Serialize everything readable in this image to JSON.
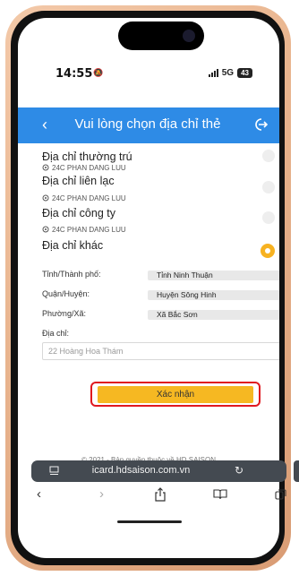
{
  "status": {
    "time": "14:55",
    "network": "5G",
    "battery": "43"
  },
  "header": {
    "title": "Vui lòng chọn địa chỉ thẻ"
  },
  "addresses": [
    {
      "label": "Địa chỉ thường trú",
      "detail": "24C PHAN DANG LUU",
      "selected": false
    },
    {
      "label": "Địa chỉ liên lạc",
      "detail": "24C PHAN DANG LUU",
      "selected": false
    },
    {
      "label": "Địa chỉ công ty",
      "detail": "24C PHAN DANG LUU",
      "selected": false
    },
    {
      "label": "Địa chỉ khác",
      "selected": true
    }
  ],
  "form": {
    "province_label": "Tỉnh/Thành phố:",
    "province_value": "Tỉnh Ninh Thuận",
    "district_label": "Quận/Huyện:",
    "district_value": "Huyện Sông Hinh",
    "ward_label": "Phường/Xã:",
    "ward_value": "Xã Bắc Sơn",
    "address_label": "Địa chỉ:",
    "address_value": "22 Hoàng Hoa Thám",
    "confirm_label": "Xác nhận"
  },
  "footer": {
    "text": "© 2021 - Bản quyền thuộc về HD SAISON"
  },
  "browser": {
    "url": "icard.hdsaison.com.vn"
  },
  "colors": {
    "header": "#2e8be6",
    "accent": "#f6b822",
    "highlight": "#e0191f"
  }
}
